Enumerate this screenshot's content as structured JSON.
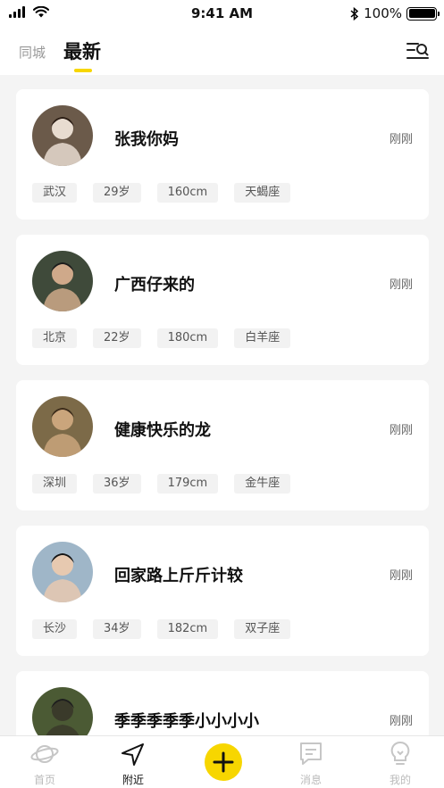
{
  "status_bar": {
    "time": "9:41 AM",
    "battery": "100%",
    "battery_level": 1.0,
    "icons": [
      "signal-icon",
      "wifi-icon",
      "bluetooth-icon",
      "battery-icon"
    ]
  },
  "top_nav": {
    "tab_nearby": "同城",
    "tab_latest": "最新",
    "active_tab": "最新",
    "accent_color": "#f7d600",
    "filter_icon": "filter-search-icon"
  },
  "users": [
    {
      "name": "张我你妈",
      "time": "刚刚",
      "tags": [
        "武汉",
        "29岁",
        "160cm",
        "天蝎座"
      ]
    },
    {
      "name": "广西仔来的",
      "time": "刚刚",
      "tags": [
        "北京",
        "22岁",
        "180cm",
        "白羊座"
      ]
    },
    {
      "name": "健康快乐的龙",
      "time": "刚刚",
      "tags": [
        "深圳",
        "36岁",
        "179cm",
        "金牛座"
      ]
    },
    {
      "name": "回家路上斤斤计较",
      "time": "刚刚",
      "tags": [
        "长沙",
        "34岁",
        "182cm",
        "双子座"
      ]
    },
    {
      "name": "季季季季季小小小小",
      "time": "刚刚",
      "tags": []
    }
  ],
  "tab_bar": {
    "items": [
      {
        "label": "首页",
        "icon": "planet-icon",
        "active": false
      },
      {
        "label": "附近",
        "icon": "navigation-arrow-icon",
        "active": true
      },
      {
        "label": "",
        "icon": "plus-icon",
        "active": false
      },
      {
        "label": "消息",
        "icon": "message-icon",
        "active": false
      },
      {
        "label": "我的",
        "icon": "lightbulb-icon",
        "active": false
      }
    ]
  }
}
